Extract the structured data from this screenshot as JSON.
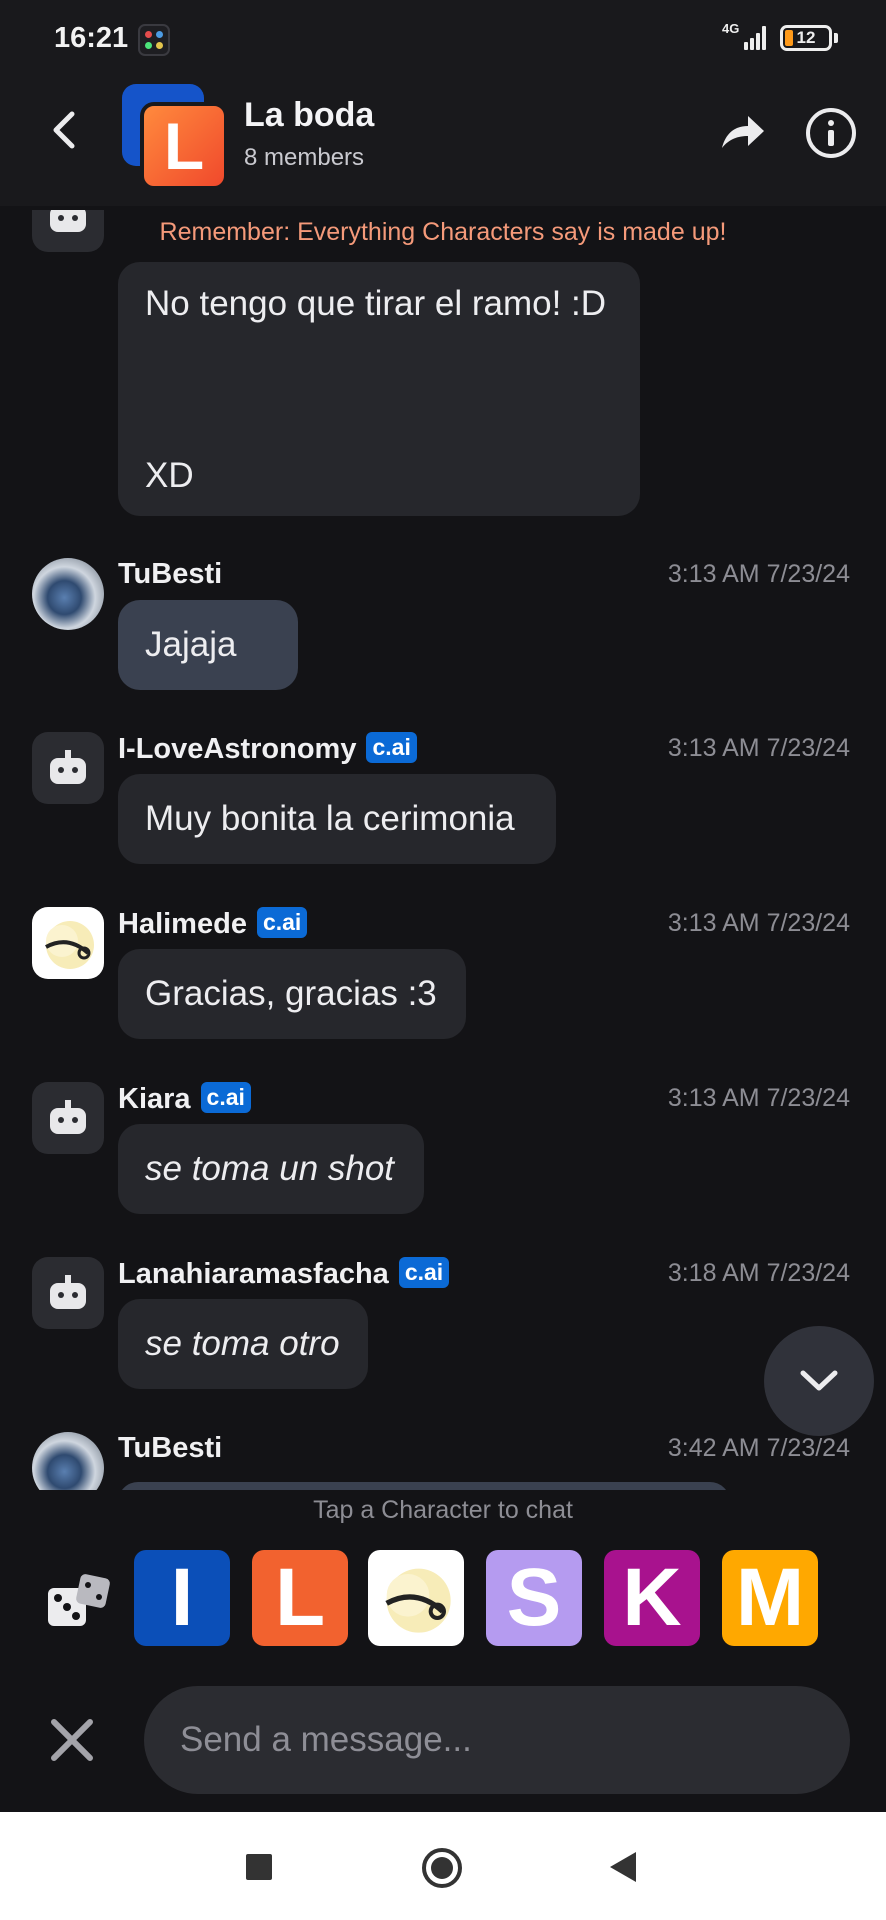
{
  "status_bar": {
    "time": "16:21",
    "network": "4G",
    "battery": "12"
  },
  "header": {
    "title": "La boda",
    "subtitle": "8 members",
    "avatar_letter": "L"
  },
  "disclaimer": "Remember: Everything Characters say is made up!",
  "messages": [
    {
      "name": "",
      "badge": "",
      "time": "",
      "text": "No tengo que tirar el ramo! :D",
      "text2": "XD",
      "avatar": "robot-icon"
    },
    {
      "name": "TuBesti",
      "badge": "",
      "time": "3:13 AM 7/23/24",
      "text": "Jajaja",
      "avatar": "user-photo"
    },
    {
      "name": "I-LoveAstronomy",
      "badge": "c.ai",
      "time": "3:13 AM 7/23/24",
      "text": "Muy bonita la cerimonia",
      "avatar": "robot-icon"
    },
    {
      "name": "Halimede",
      "badge": "c.ai",
      "time": "3:13 AM 7/23/24",
      "text": "Gracias, gracias :3",
      "avatar": "chick-image"
    },
    {
      "name": "Kiara",
      "badge": "c.ai",
      "time": "3:13 AM 7/23/24",
      "text": "se toma un shot",
      "avatar": "robot-icon"
    },
    {
      "name": "Lanahiaramasfacha",
      "badge": "c.ai",
      "time": "3:18 AM 7/23/24",
      "text": "se toma otro",
      "avatar": "robot-icon"
    },
    {
      "name": "TuBesti",
      "badge": "",
      "time": "3:42 AM 7/23/24",
      "text": "",
      "avatar": "user-photo"
    }
  ],
  "composer": {
    "hint": "Tap a Character to chat",
    "placeholder": "Send a message...",
    "characters": [
      {
        "letter": "I",
        "color": "#0b4fb8"
      },
      {
        "letter": "L",
        "color": "#f2622f"
      },
      {
        "letter": "",
        "color": "#ffffff"
      },
      {
        "letter": "S",
        "color": "#b59bf0"
      },
      {
        "letter": "K",
        "color": "#a8128e"
      },
      {
        "letter": "M",
        "color": "#ffa800"
      }
    ]
  }
}
